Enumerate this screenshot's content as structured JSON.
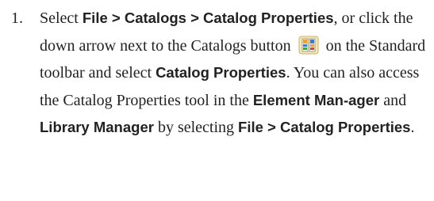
{
  "step": {
    "number": "1.",
    "text_1": "Select ",
    "bold_1": "File > Catalogs > Catalog Properties",
    "text_2": ", or click the down arrow next to the Catalogs button ",
    "icon": "catalogs-toolbar-icon",
    "text_3": " on the Standard toolbar and select ",
    "bold_2": "Catalog Properties",
    "text_4": ". You can also access the Catalog Properties tool in the ",
    "bold_3": "Element Man-ager",
    "text_5": " and ",
    "bold_4": "Library Manager",
    "text_6": " by selecting ",
    "bold_5": "File > Catalog Properties",
    "text_7": "."
  }
}
